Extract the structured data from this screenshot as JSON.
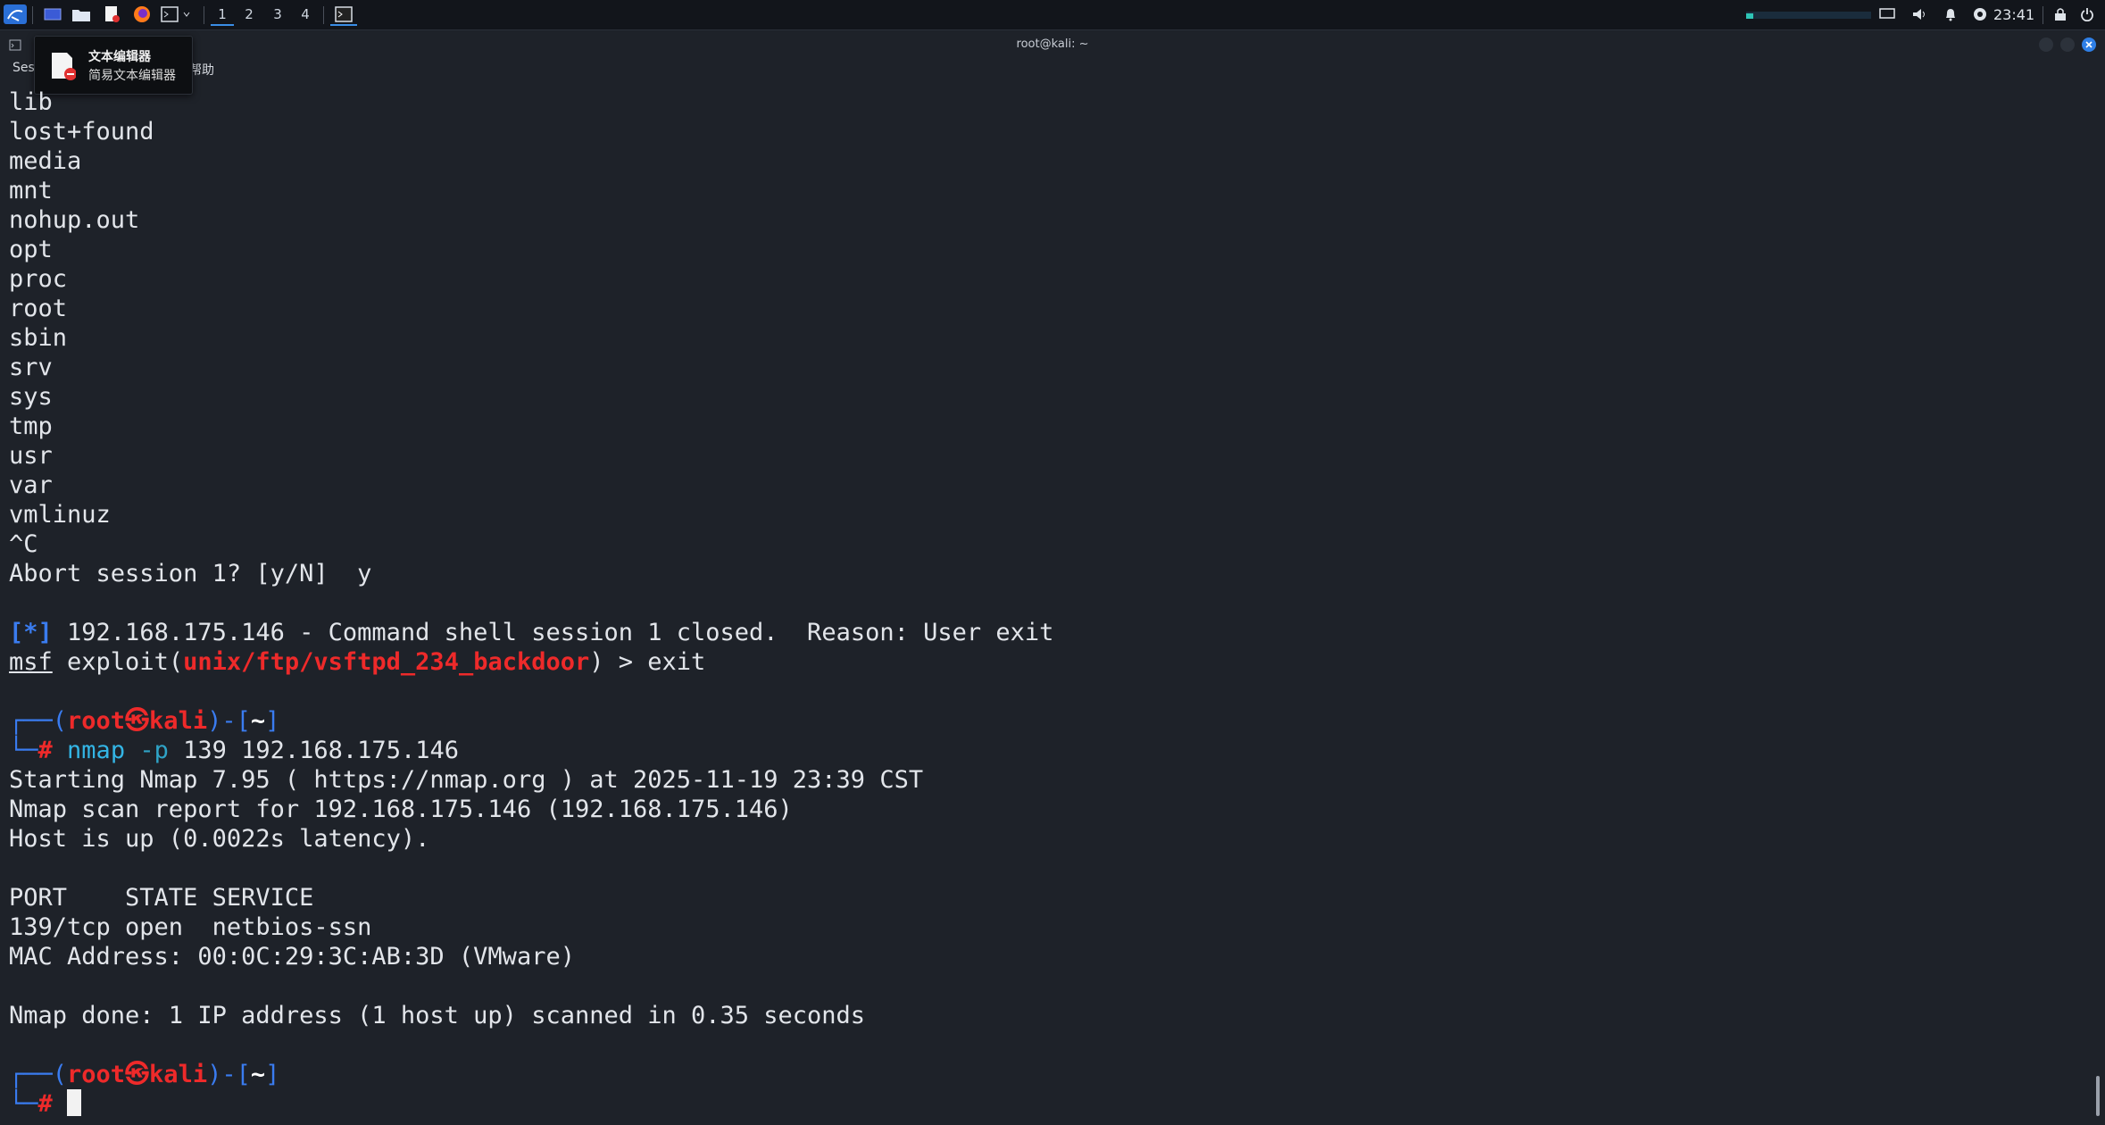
{
  "panel": {
    "workspaces": [
      "1",
      "2",
      "3",
      "4"
    ],
    "clock": "23:41",
    "icons": [
      "kali-menu-icon",
      "show-desktop-icon",
      "file-manager-icon",
      "text-editor-icon",
      "firefox-icon",
      "terminal-icon",
      "terminal-window-icon",
      "display-icon",
      "volume-icon",
      "bell-icon",
      "network-icon",
      "lock-icon",
      "power-icon"
    ]
  },
  "window": {
    "title": "root@kali: ~",
    "menu_left": "Ses",
    "menu_help": "帮助"
  },
  "tooltip": {
    "title": "文本编辑器",
    "subtitle": "简易文本编辑器"
  },
  "terminal": {
    "ls_lines": [
      "lib",
      "lost+found",
      "media",
      "mnt",
      "nohup.out",
      "opt",
      "proc",
      "root",
      "sbin",
      "srv",
      "sys",
      "tmp",
      "usr",
      "var",
      "vmlinuz",
      "^C",
      "Abort session 1? [y/N]  y"
    ],
    "status_tag": "[*]",
    "status_text": " 192.168.175.146 - Command shell session 1 closed.  Reason: User exit",
    "msf_prompt": "msf",
    "msf_exploit": " exploit(",
    "msf_module": "unix/ftp/vsftpd_234_backdoor",
    "msf_tail": ") > exit",
    "prompt_open": "┌──(",
    "prompt_user": "root㉿kali",
    "prompt_close": ")-[",
    "prompt_dir": "~",
    "prompt_end": "]",
    "prompt_hash_prefix": "└─",
    "prompt_hash": "#",
    "cmd_name": "nmap",
    "cmd_opt": "-p",
    "cmd_args": " 139 192.168.175.146",
    "nmap_lines": [
      "Starting Nmap 7.95 ( https://nmap.org ) at 2025-11-19 23:39 CST",
      "Nmap scan report for 192.168.175.146 (192.168.175.146)",
      "Host is up (0.0022s latency).",
      "",
      "PORT    STATE SERVICE",
      "139/tcp open  netbios-ssn",
      "MAC Address: 00:0C:29:3C:AB:3D (VMware)",
      "",
      "Nmap done: 1 IP address (1 host up) scanned in 0.35 seconds"
    ]
  }
}
